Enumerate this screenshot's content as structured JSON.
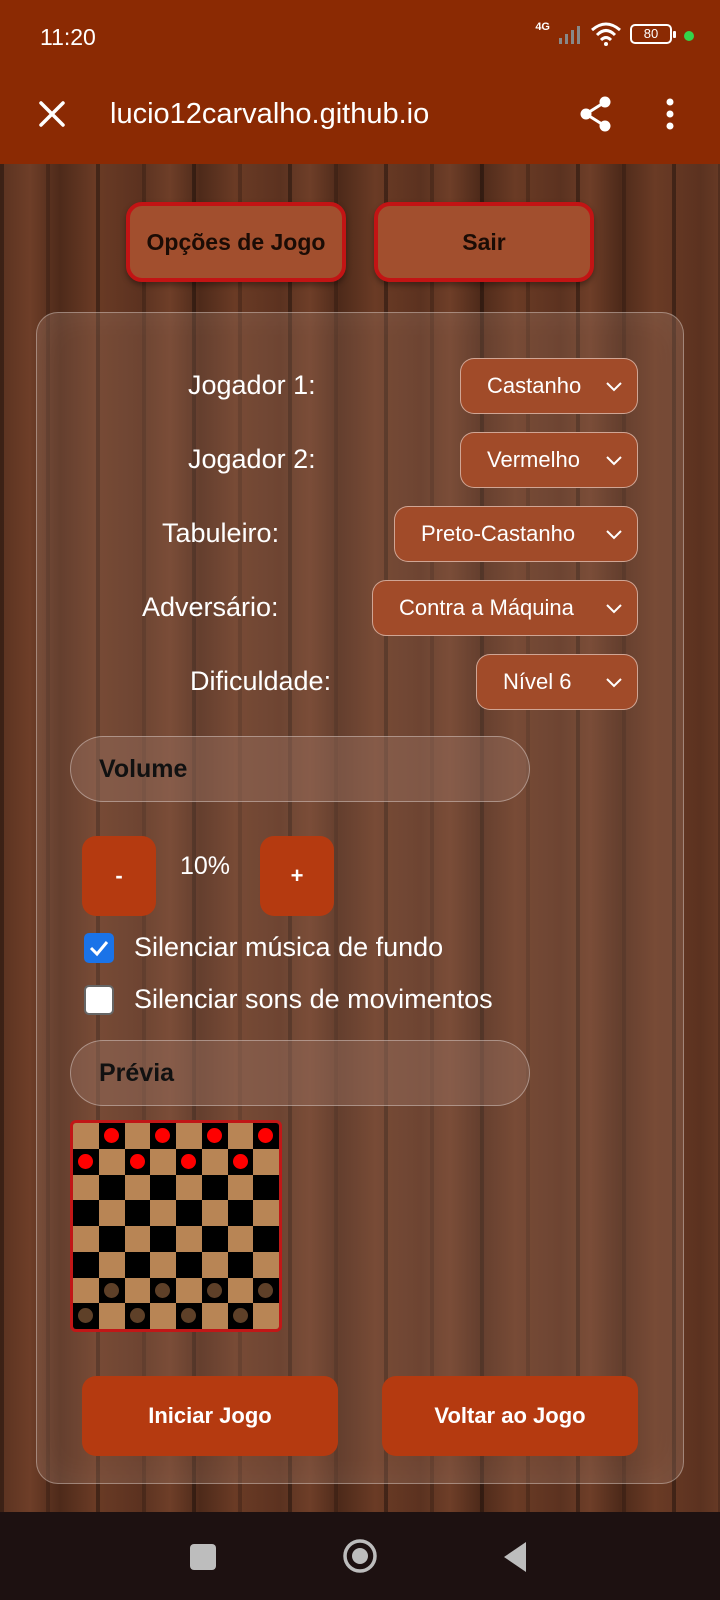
{
  "status": {
    "time": "11:20",
    "network": "4G",
    "battery": "80"
  },
  "browser": {
    "url": "lucio12carvalho.github.io"
  },
  "top_buttons": {
    "options": "Opções de Jogo",
    "exit": "Sair"
  },
  "settings": [
    {
      "label": "Jogador 1:",
      "value": "Castanho"
    },
    {
      "label": "Jogador 2:",
      "value": "Vermelho"
    },
    {
      "label": "Tabuleiro:",
      "value": "Preto-Castanho"
    },
    {
      "label": "Adversário:",
      "value": "Contra a Máquina"
    },
    {
      "label": "Dificuldade:",
      "value": "Nível 6"
    }
  ],
  "volume": {
    "title": "Volume",
    "minus": "-",
    "plus": "+",
    "value": "10%"
  },
  "checks": [
    {
      "label": "Silenciar música de fundo",
      "checked": true
    },
    {
      "label": "Silenciar sons de movimentos",
      "checked": false
    }
  ],
  "preview": {
    "title": "Prévia",
    "board": [
      ". r . r . r . r",
      "r . r . r . r .",
      ". . . . . . . .",
      ". . . . . . . .",
      ". . . . . . . .",
      ". . . . . . . .",
      ". b . b . b . b",
      "b . b . b . b ."
    ]
  },
  "bottom_buttons": {
    "start": "Iniciar Jogo",
    "back": "Voltar ao Jogo"
  },
  "colors": {
    "accent": "#b53a10",
    "header": "#8b2a03",
    "piece_red": "#ff0000",
    "piece_brown": "#5e4028",
    "board_light": "#b88555",
    "board_dark": "#000000"
  }
}
